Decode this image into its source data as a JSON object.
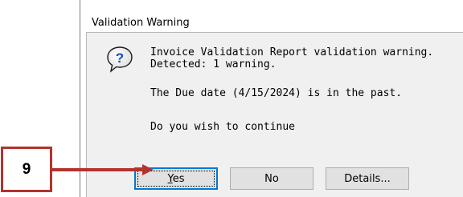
{
  "dialog": {
    "title": "Validation Warning",
    "icon": "question-icon",
    "message_line1": "Invoice Validation Report validation warning.",
    "message_line2": "Detected: 1 warning.",
    "message_detail": "The Due date (4/15/2024) is in the past.",
    "message_prompt": "Do you wish to continue",
    "buttons": {
      "yes": {
        "mnemonic": "Y",
        "rest": "es"
      },
      "no": "No",
      "details": "Details..."
    }
  },
  "annotation": {
    "step_number": "9",
    "color": "#b3332e"
  }
}
